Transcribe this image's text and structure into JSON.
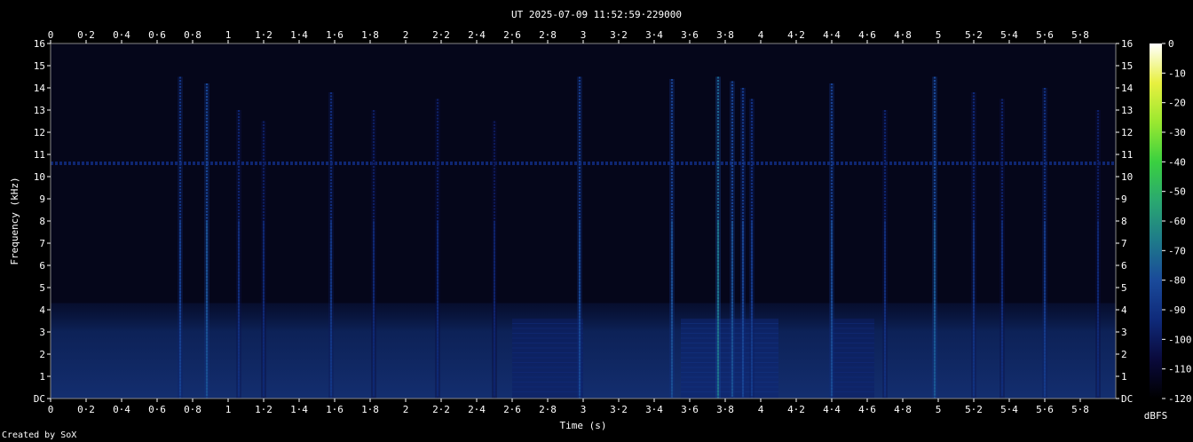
{
  "chart_data": {
    "type": "heatmap",
    "title": "UT 2025-07-09 11:52:59·229000",
    "xlabel": "Time (s)",
    "ylabel": "Frequency (kHz)",
    "xlim": [
      0,
      6
    ],
    "ylim": [
      0,
      16
    ],
    "x_ticks": [
      "0",
      "0·2",
      "0·4",
      "0·6",
      "0·8",
      "1",
      "1·2",
      "1·4",
      "1·6",
      "1·8",
      "2",
      "2·2",
      "2·4",
      "2·6",
      "2·8",
      "3",
      "3·2",
      "3·4",
      "3·6",
      "3·8",
      "4",
      "4·2",
      "4·4",
      "4·6",
      "4·8",
      "5",
      "5·2",
      "5·4",
      "5·6",
      "5·8"
    ],
    "y_ticks": [
      "DC",
      "1",
      "2",
      "3",
      "4",
      "5",
      "6",
      "7",
      "8",
      "9",
      "10",
      "11",
      "12",
      "13",
      "14",
      "15",
      "16"
    ],
    "colorbar": {
      "label": "dBFS",
      "ticks": [
        "0",
        "-10",
        "-20",
        "-30",
        "-40",
        "-50",
        "-60",
        "-70",
        "-80",
        "-90",
        "-100",
        "-110",
        "-120"
      ],
      "range": [
        -120,
        0
      ],
      "stops": [
        "#000000",
        "#0a0a3c",
        "#0f2a7a",
        "#1a4a9a",
        "#1e7a8a",
        "#2aa870",
        "#3ad040",
        "#9ae830",
        "#e8f040",
        "#ffffff"
      ]
    },
    "background_level_db": -110,
    "bands": [
      {
        "name": "tone_10_6kHz",
        "freq_khz": 10.6,
        "t_start": 0,
        "t_end": 6,
        "level_db": -95
      },
      {
        "name": "low_noise",
        "f_low": 0,
        "f_high": 4.3,
        "t_start": 0,
        "t_end": 6,
        "level_db": -103
      }
    ],
    "bursts": [
      {
        "t_start": 2.6,
        "t_end": 3.0,
        "f_high": 3.6,
        "level_db": -98
      },
      {
        "t_start": 3.55,
        "t_end": 4.1,
        "f_high": 3.6,
        "level_db": -95
      },
      {
        "t_start": 4.4,
        "t_end": 4.64,
        "f_high": 3.6,
        "level_db": -98
      }
    ],
    "transients": [
      {
        "t": 0.73,
        "f_high": 14.5,
        "level_db": -88
      },
      {
        "t": 0.88,
        "f_high": 14.2,
        "level_db": -82
      },
      {
        "t": 1.06,
        "f_high": 13.0,
        "level_db": -95
      },
      {
        "t": 1.2,
        "f_high": 12.5,
        "level_db": -98
      },
      {
        "t": 1.58,
        "f_high": 13.8,
        "level_db": -92
      },
      {
        "t": 1.82,
        "f_high": 13.0,
        "level_db": -98
      },
      {
        "t": 2.18,
        "f_high": 13.5,
        "level_db": -98
      },
      {
        "t": 2.5,
        "f_high": 12.5,
        "level_db": -100
      },
      {
        "t": 2.98,
        "f_high": 14.5,
        "level_db": -85
      },
      {
        "t": 3.5,
        "f_high": 14.4,
        "level_db": -83
      },
      {
        "t": 3.76,
        "f_high": 14.5,
        "level_db": -72
      },
      {
        "t": 3.84,
        "f_high": 14.3,
        "level_db": -82
      },
      {
        "t": 3.9,
        "f_high": 14.0,
        "level_db": -86
      },
      {
        "t": 3.95,
        "f_high": 13.5,
        "level_db": -90
      },
      {
        "t": 4.4,
        "f_high": 14.2,
        "level_db": -84
      },
      {
        "t": 4.7,
        "f_high": 13.0,
        "level_db": -95
      },
      {
        "t": 4.98,
        "f_high": 14.5,
        "level_db": -80
      },
      {
        "t": 5.2,
        "f_high": 13.8,
        "level_db": -94
      },
      {
        "t": 5.36,
        "f_high": 13.5,
        "level_db": -96
      },
      {
        "t": 5.6,
        "f_high": 14.0,
        "level_db": -90
      },
      {
        "t": 5.9,
        "f_high": 13.0,
        "level_db": -98
      }
    ]
  },
  "footer": {
    "credit": "Created by SoX"
  }
}
